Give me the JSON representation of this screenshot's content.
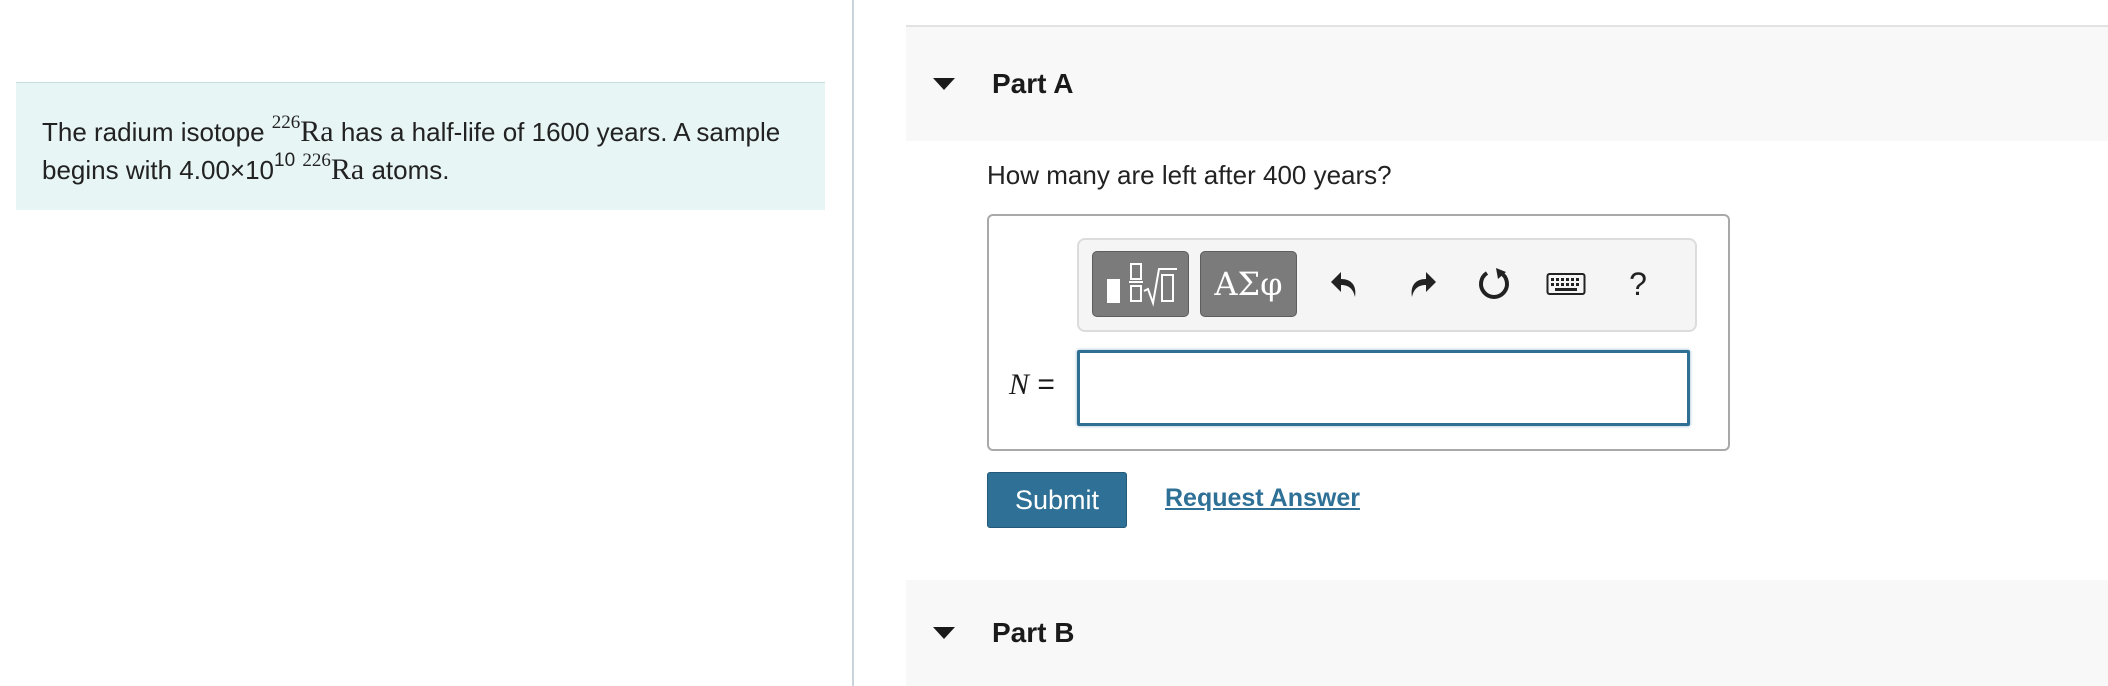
{
  "intro": {
    "text_before": "The radium isotope ",
    "isotope_mass": "226",
    "isotope_symbol": "Ra",
    "text_middle": " has a half-life of 1600 years. A sample begins with 4.00×10",
    "exponent": "10",
    "text_after": " atoms."
  },
  "part_a": {
    "title": "Part A",
    "question": "How many are left after 400 years?",
    "toolbar": {
      "greek_label": "ΑΣφ",
      "help_label": "?"
    },
    "variable": "N",
    "equals": " =",
    "input_value": "",
    "submit_label": "Submit",
    "request_label": "Request Answer"
  },
  "part_b": {
    "title": "Part B"
  }
}
